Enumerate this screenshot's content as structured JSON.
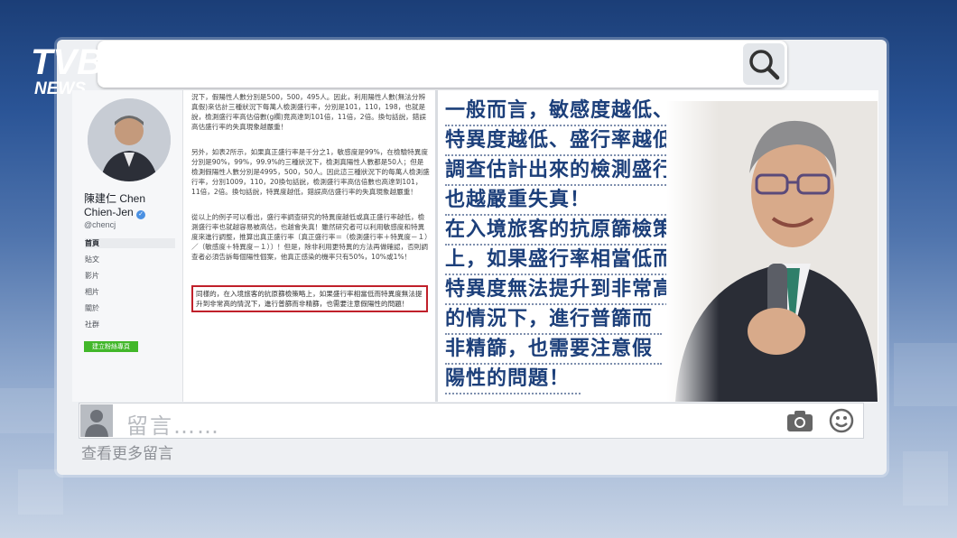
{
  "brand": {
    "logo_main": "TVBS",
    "logo_sub": "NEWS",
    "colors": {
      "bg_dark": "#1b3e77",
      "quote_blue": "#1c3f7a",
      "highlight_red": "#c0202a"
    }
  },
  "search": {
    "icon": "search-icon"
  },
  "profile": {
    "name_line1": "陳建仁 Chen",
    "name_line2": "Chien-Jen",
    "handle": "@chencj",
    "nav": [
      "首頁",
      "貼文",
      "影片",
      "相片",
      "關於",
      "社群"
    ],
    "create_page": "建立粉絲專頁"
  },
  "post": {
    "para1": "況下，假陽性人數分別是500，500，495人。因此，利用陽性人數(無法分辨真假)來估計三種狀況下每萬人檢測盛行率，分別是101，110，198，也就是說，檢測盛行率高估倍數(g欄)竟高達到101倍，11倍，2倍。換句話說，錯誤高估盛行率的失真現象越嚴重！",
    "para2": "另外，如表2所示，如果真正盛行率是千分之1，敏感度是99%，在檢驗特異度分別是90%，99%，99.9%的三種狀況下，檢測真陽性人數都是50人；但是檢測假陽性人數分別是4995，500，50人。因此這三種狀況下的每萬人檢測盛行率，分別1009，110，20換句話說，檢測盛行率高估倍數也高達到101，11倍，2倍。換句話說，特異度越低，錯誤高估盛行率的失真現象越嚴重！",
    "para3": "從以上的例子可以看出，盛行率調查研究的特異度越低或真正盛行率越低，檢測盛行率也就越容易被高估，也越會失真！雖然研究者可以利用敏感度和特異度來進行調整，推算出真正盛行率〔真正盛行率＝（檢測盛行率＋特異度－１）／（敏感度＋特異度－１）〕！但是，除非利用更特異的方法再做確認，否則調查者必須告訴每個陽性個案，他真正感染的機率只有50%，10%或1%！",
    "para4": "同樣的，在入境旅客的抗原篩檢策略上，如果盛行率相當低而特異度無法提升到非常高的情況下，進行普篩而非精篩，也需要注意假陽性的問題！"
  },
  "quote_lines": [
    "一般而言，敏感度越低、",
    "特異度越低、盛行率越低，",
    "調查估計出來的檢測盛行率",
    "也越嚴重失真！",
    "在入境旅客的抗原篩檢策略",
    "上，如果盛行率相當低而",
    "特異度無法提升到非常高",
    "的情況下，進行普篩而",
    "非精篩，也需要注意假",
    "陽性的問題！"
  ],
  "comment": {
    "placeholder": "留言……",
    "see_more": "查看更多留言",
    "camera_icon": "camera-icon",
    "emoji_icon": "smiley-icon"
  }
}
